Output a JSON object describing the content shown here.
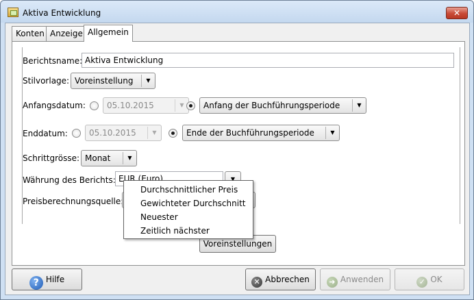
{
  "window": {
    "title": "Aktiva Entwicklung",
    "close_label": "✕"
  },
  "tabs": [
    "Konten",
    "Anzeige",
    "Allgemein"
  ],
  "form": {
    "report_name_label": "Berichtsname:",
    "report_name_value": "Aktiva Entwicklung",
    "style_label": "Stilvorlage:",
    "style_value": "Voreinstellung",
    "start_date_label": "Anfangsdatum:",
    "start_date_value": "05.10.2015",
    "start_period_value": "Anfang der Buchführungsperiode",
    "end_date_label": "Enddatum:",
    "end_date_value": "05.10.2015",
    "end_period_value": "Ende der Buchführungsperiode",
    "step_label": "Schrittgrösse:",
    "step_value": "Monat",
    "currency_label": "Währung des Berichts:",
    "currency_value": "EUR (Euro)",
    "price_source_label": "Preisberechnungsquelle:",
    "defaults_button": "Voreinstellungen"
  },
  "dropdown_options": [
    "Durchschnittlicher Preis",
    "Gewichteter Durchschnitt",
    "Neuester",
    "Zeitlich nächster"
  ],
  "buttons": {
    "help": "Hilfe",
    "cancel": "Abbrechen",
    "apply": "Anwenden",
    "ok": "OK"
  },
  "icons": {
    "app": "report-icon",
    "help": "help-icon",
    "cancel": "cancel-icon",
    "apply": "apply-icon",
    "ok": "ok-icon"
  },
  "colors": {
    "title_bar": "#cfe0f3",
    "close_button": "#c84a36",
    "help_icon": "#1f5bb5"
  }
}
